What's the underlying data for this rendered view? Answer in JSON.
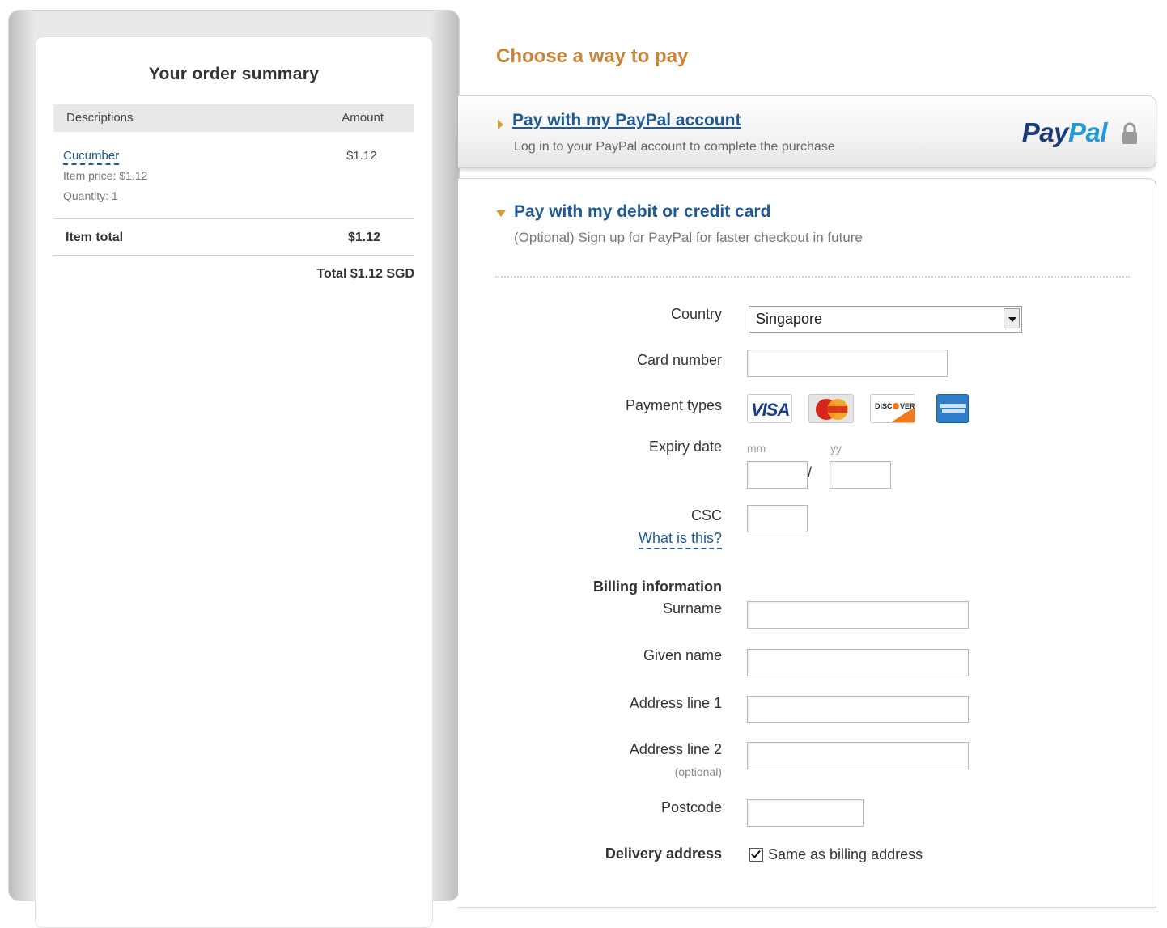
{
  "summary": {
    "title": "Your order summary",
    "col_desc": "Descriptions",
    "col_amount": "Amount",
    "item": {
      "name": "Cucumber",
      "amount": "$1.12",
      "price": "Item price: $1.12",
      "quantity": "Quantity: 1"
    },
    "item_total_label": "Item total",
    "item_total_value": "$1.12",
    "total_label": "Total",
    "total_value": "$1.12 SGD"
  },
  "payment": {
    "title": "Choose a way to pay",
    "paypal": {
      "title": "Pay with my PayPal account",
      "subtitle": "Log in to your PayPal account to complete the purchase",
      "logo_part1": "Pay",
      "logo_part2": "Pal"
    },
    "card": {
      "title": "Pay with my debit or credit card",
      "subtitle": "(Optional) Sign up for PayPal for faster checkout in future"
    }
  },
  "form": {
    "country_label": "Country",
    "country_value": "Singapore",
    "card_number_label": "Card number",
    "card_number_value": "",
    "payment_types_label": "Payment types",
    "card_types": [
      "VISA",
      "MasterCard",
      "DISCOVER",
      "American Express"
    ],
    "expiry_label": "Expiry date",
    "expiry_mm": "mm",
    "expiry_yy": "yy",
    "expiry_separator": "/",
    "csc_label": "CSC",
    "csc_help": "What is this?",
    "billing_heading": "Billing information",
    "surname_label": "Surname",
    "given_name_label": "Given name",
    "address1_label": "Address line 1",
    "address2_label": "Address line 2",
    "address2_hint": "(optional)",
    "postcode_label": "Postcode",
    "delivery_label": "Delivery address",
    "same_as_billing_label": "Same as billing address",
    "same_as_billing_checked": true
  },
  "colors": {
    "accent_orange": "#c8843a",
    "link_blue": "#1f5a97",
    "paypal_dark": "#1b3a7a",
    "paypal_light": "#2598d6"
  }
}
